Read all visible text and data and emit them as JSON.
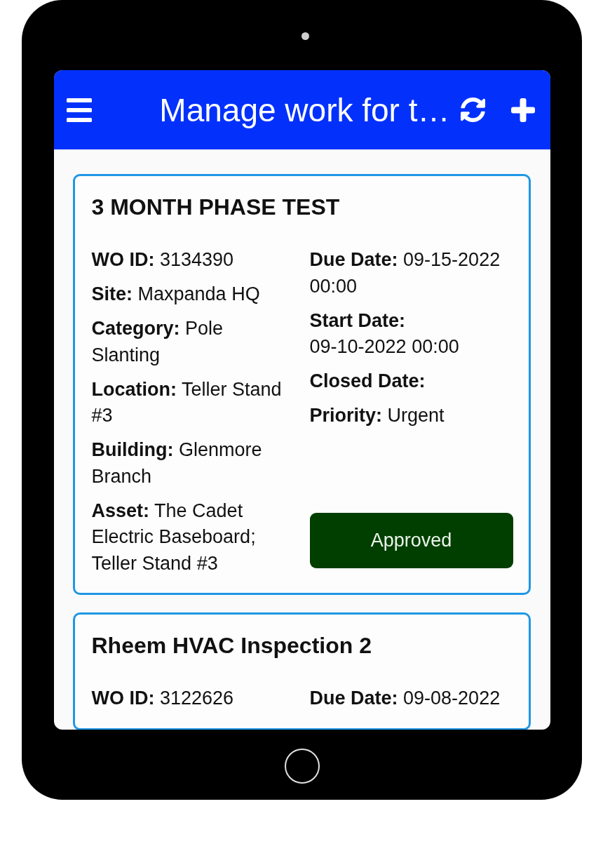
{
  "header": {
    "title": "Manage work for t…"
  },
  "work_orders": [
    {
      "title": "3 MONTH PHASE TEST",
      "left_fields": [
        {
          "label": "WO ID:",
          "value": "3134390"
        },
        {
          "label": "Site:",
          "value": "Maxpanda HQ"
        },
        {
          "label": "Category:",
          "value": "Pole Slanting"
        },
        {
          "label": "Location:",
          "value": "Teller Stand #3"
        },
        {
          "label": "Building:",
          "value": "Glenmore Branch"
        },
        {
          "label": "Asset:",
          "value": "The Cadet Electric Baseboard; Teller Stand #3"
        }
      ],
      "right_fields": [
        {
          "label": "Due Date:",
          "value": "09-15-2022 00:00"
        },
        {
          "label": "Start Date:",
          "value": "09-10-2022 00:00"
        },
        {
          "label": "Closed Date:"
        },
        {
          "label": "Priority:",
          "value": "Urgent"
        }
      ],
      "status": {
        "label": "Approved"
      }
    },
    {
      "title": "Rheem HVAC Inspection 2",
      "left_fields": [
        {
          "label": "WO ID:",
          "value": "3122626"
        }
      ],
      "right_fields": [
        {
          "label": "Due Date:",
          "value": "09-08-2022"
        }
      ]
    }
  ]
}
